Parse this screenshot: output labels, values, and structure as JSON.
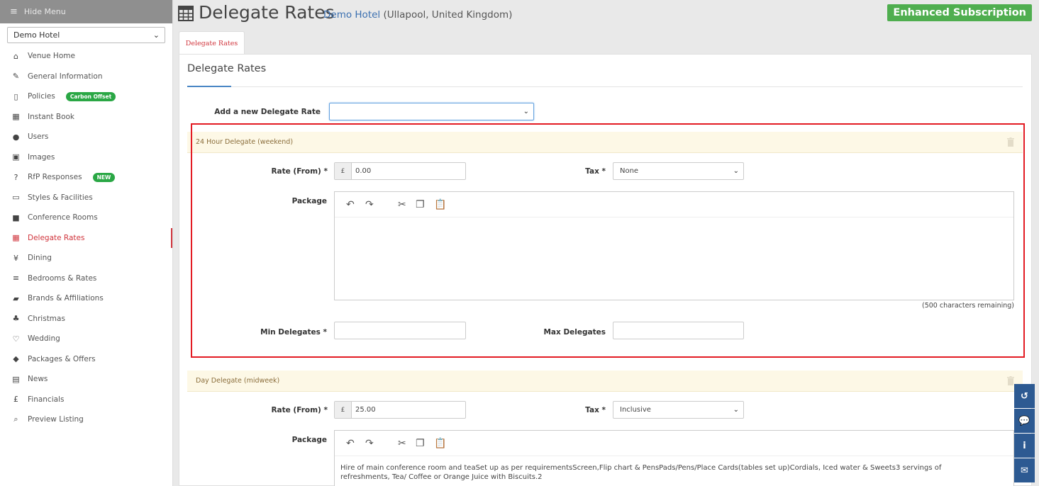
{
  "sidebar": {
    "hide_menu_label": "Hide Menu",
    "venue_select_value": "Demo Hotel",
    "items": [
      {
        "label": "Venue Home",
        "icon": "home-icon"
      },
      {
        "label": "General Information",
        "icon": "edit-icon"
      },
      {
        "label": "Policies",
        "icon": "document-icon",
        "badge": "Carbon Offset"
      },
      {
        "label": "Instant Book",
        "icon": "calendar-icon"
      },
      {
        "label": "Users",
        "icon": "user-icon"
      },
      {
        "label": "Images",
        "icon": "image-icon"
      },
      {
        "label": "RfP Responses",
        "icon": "question-icon",
        "badge": "NEW"
      },
      {
        "label": "Styles & Facilities",
        "icon": "monitor-icon"
      },
      {
        "label": "Conference Rooms",
        "icon": "briefcase-icon"
      },
      {
        "label": "Delegate Rates",
        "icon": "table-icon",
        "active": true
      },
      {
        "label": "Dining",
        "icon": "cutlery-icon"
      },
      {
        "label": "Bedrooms & Rates",
        "icon": "bed-icon"
      },
      {
        "label": "Brands & Affiliations",
        "icon": "book-icon"
      },
      {
        "label": "Christmas",
        "icon": "tree-icon"
      },
      {
        "label": "Wedding",
        "icon": "heart-icon"
      },
      {
        "label": "Packages & Offers",
        "icon": "tags-icon"
      },
      {
        "label": "News",
        "icon": "newspaper-icon"
      },
      {
        "label": "Financials",
        "icon": "pound-icon"
      },
      {
        "label": "Preview Listing",
        "icon": "search-icon"
      }
    ]
  },
  "header": {
    "title": "Delegate Rates",
    "venue_name": "Demo Hotel",
    "venue_location": " (Ullapool, United Kingdom)",
    "subscription_label": "Enhanced Subscription"
  },
  "tab": {
    "label": "Delegate Rates"
  },
  "panel": {
    "title": "Delegate Rates",
    "add_label": "Add a new Delegate Rate",
    "add_value": ""
  },
  "rates": [
    {
      "name": "24 Hour Delegate (weekend)",
      "rate_label": "Rate (From) *",
      "currency": "£",
      "rate_value": "0.00",
      "tax_label": "Tax *",
      "tax_value": "None",
      "package_label": "Package",
      "package_text": "",
      "remaining": "(500 characters remaining)",
      "min_label": "Min Delegates *",
      "min_value": "",
      "max_label": "Max Delegates",
      "max_value": ""
    },
    {
      "name": "Day Delegate (midweek)",
      "rate_label": "Rate (From) *",
      "currency": "£",
      "rate_value": "25.00",
      "tax_label": "Tax *",
      "tax_value": "Inclusive",
      "package_label": "Package",
      "package_text": "Hire of main conference room and teaSet up as per requirementsScreen,Flip chart & PensPads/Pens/Place Cards(tables set up)Cordials, Iced water & Sweets3 servings of refreshments, Tea/ Coffee or Orange Juice with Biscuits.2"
    }
  ],
  "colors": {
    "accent": "#d0343c",
    "subscription": "#4fae4f",
    "highlight": "#e31b23",
    "float": "#2d5a92"
  }
}
